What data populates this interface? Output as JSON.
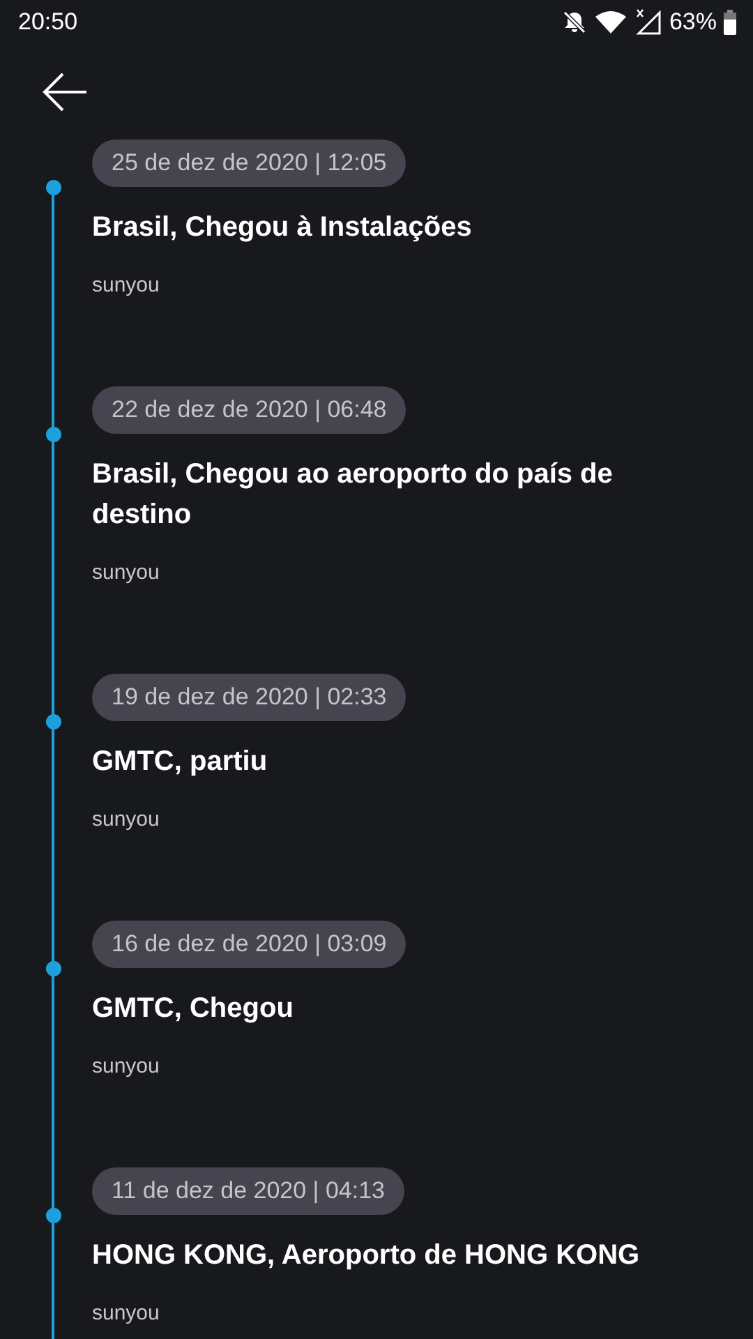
{
  "status_bar": {
    "time": "20:50",
    "battery": "63%"
  },
  "events": [
    {
      "date": "25 de dez de 2020 | 12:05",
      "title": "Brasil, Chegou à Instalações",
      "source": "sunyou"
    },
    {
      "date": "22 de dez de 2020 | 06:48",
      "title": "Brasil, Chegou ao aeroporto do país de destino",
      "source": "sunyou"
    },
    {
      "date": "19 de dez de 2020 | 02:33",
      "title": "GMTC, partiu",
      "source": "sunyou"
    },
    {
      "date": "16 de dez de 2020 | 03:09",
      "title": "GMTC, Chegou",
      "source": "sunyou"
    },
    {
      "date": "11 de dez de 2020 | 04:13",
      "title": "HONG KONG, Aeroporto de HONG KONG",
      "source": "sunyou"
    }
  ]
}
